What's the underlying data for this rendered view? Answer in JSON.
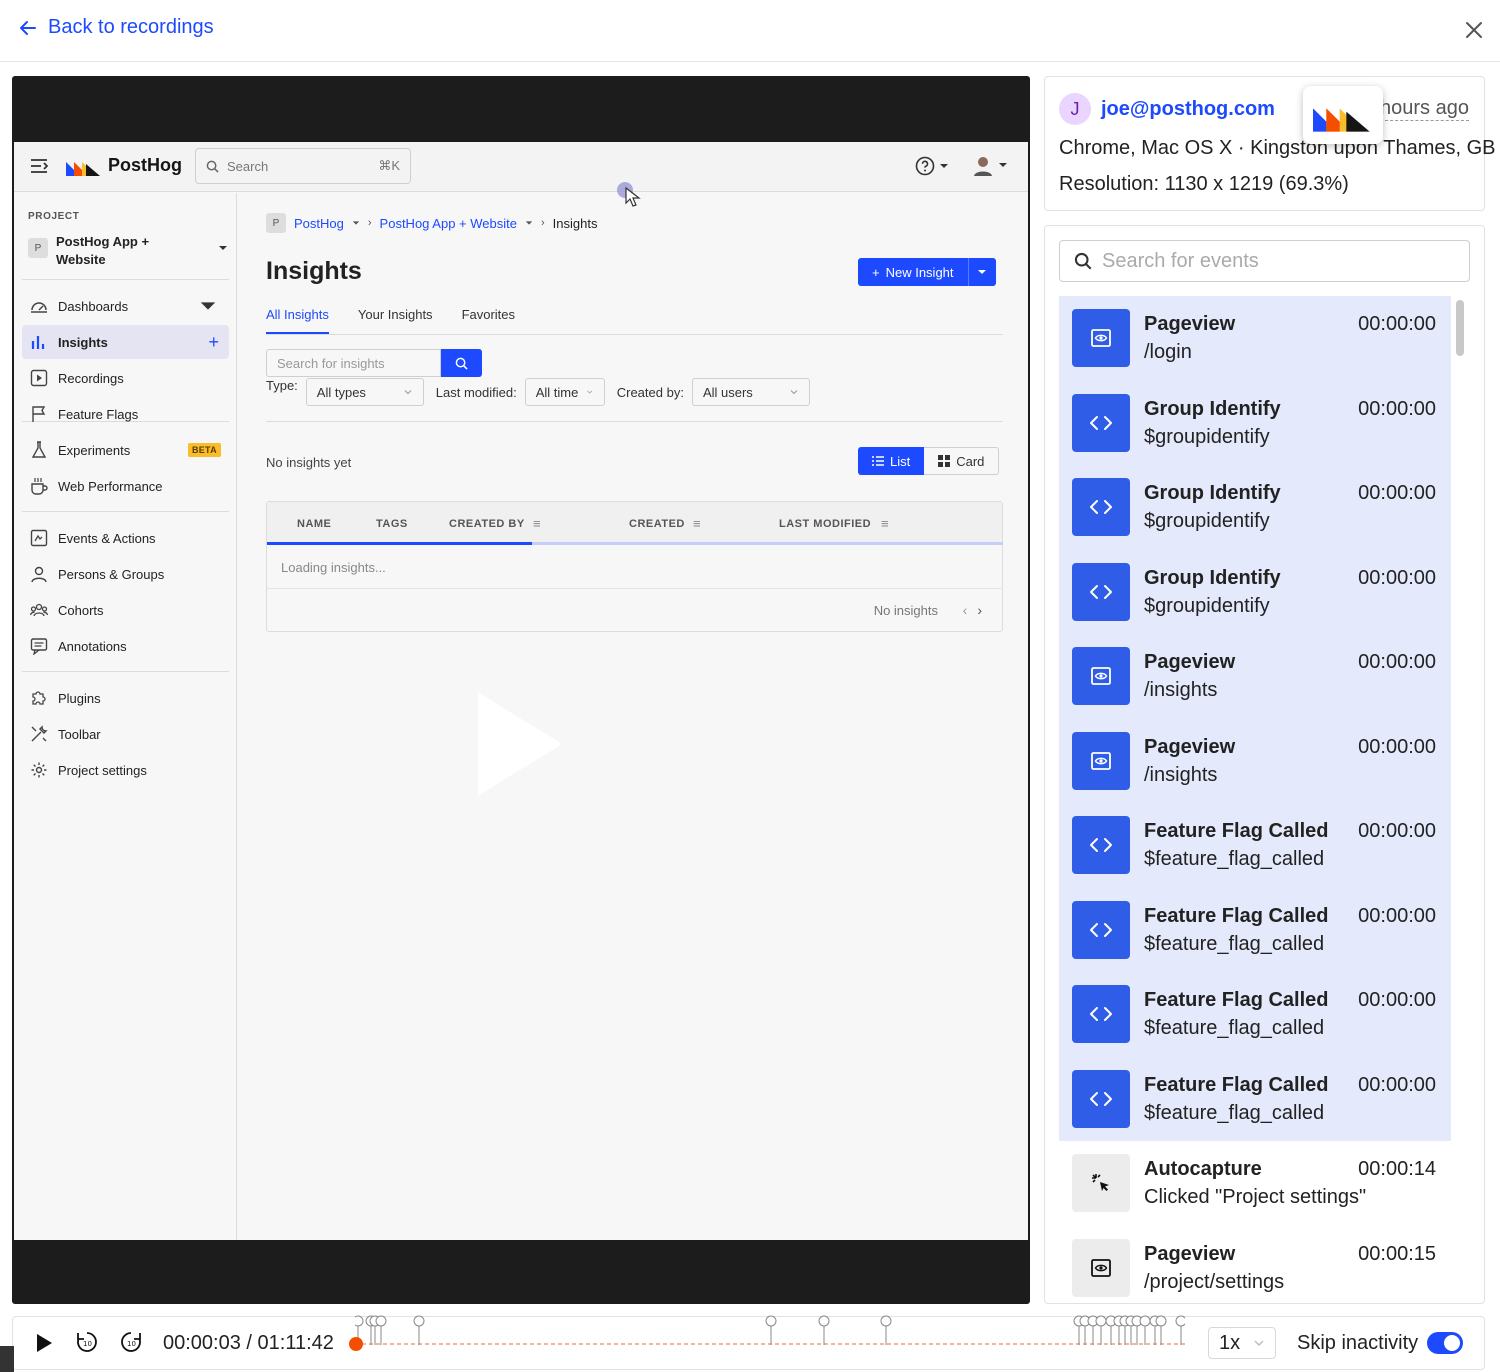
{
  "topbar": {
    "back_label": "Back to recordings"
  },
  "inner_app": {
    "logo_name": "PostHog",
    "search_placeholder": "Search",
    "search_shortcut": "⌘K",
    "project_label": "PROJECT",
    "project_badge": "P",
    "project_name": "PostHog App + Website",
    "nav": [
      {
        "label": "Dashboards",
        "icon": "dashboard-icon"
      },
      {
        "label": "Insights",
        "icon": "bar-chart-icon",
        "active": true
      },
      {
        "label": "Recordings",
        "icon": "play-square-icon"
      },
      {
        "label": "Feature Flags",
        "icon": "flag-icon"
      },
      {
        "label": "Experiments",
        "icon": "flask-icon",
        "badge": "BETA"
      },
      {
        "label": "Web Performance",
        "icon": "coffee-icon"
      },
      {
        "label": "Events & Actions",
        "icon": "events-icon"
      },
      {
        "label": "Persons & Groups",
        "icon": "person-icon"
      },
      {
        "label": "Cohorts",
        "icon": "cohort-icon"
      },
      {
        "label": "Annotations",
        "icon": "annotation-icon"
      },
      {
        "label": "Plugins",
        "icon": "puzzle-icon"
      },
      {
        "label": "Toolbar",
        "icon": "tools-icon"
      },
      {
        "label": "Project settings",
        "icon": "gear-icon"
      }
    ],
    "breadcrumb": {
      "badge": "P",
      "org": "PostHog",
      "project": "PostHog App + Website",
      "current": "Insights"
    },
    "page_title": "Insights",
    "new_insight_label": "New Insight",
    "tabs": [
      "All Insights",
      "Your Insights",
      "Favorites"
    ],
    "search_insights_placeholder": "Search for insights",
    "filters": {
      "type_label": "Type:",
      "type_value": "All types",
      "modified_label": "Last modified:",
      "modified_value": "All time",
      "created_label": "Created by:",
      "created_value": "All users"
    },
    "no_insights_yet": "No insights yet",
    "view_list": "List",
    "view_card": "Card",
    "columns": [
      "NAME",
      "TAGS",
      "CREATED BY",
      "CREATED",
      "LAST MODIFIED"
    ],
    "loading_text": "Loading insights...",
    "loading_progress": 0.36,
    "no_insights": "No insights"
  },
  "meta": {
    "avatar_letter": "J",
    "email": "joe@posthog.com",
    "ago": "hours ago",
    "device": "Chrome, Mac OS X · Kingston upon Thames, GB",
    "resolution": "Resolution: 1130 x 1219 (69.3%)"
  },
  "events": {
    "search_placeholder": "Search for events",
    "items": [
      {
        "title": "Pageview",
        "sub": "/login",
        "time": "00:00:00",
        "icon": "pageview-icon",
        "highlight": true
      },
      {
        "title": "Group Identify",
        "sub": "$groupidentify",
        "time": "00:00:00",
        "icon": "code-icon",
        "highlight": true
      },
      {
        "title": "Group Identify",
        "sub": "$groupidentify",
        "time": "00:00:00",
        "icon": "code-icon",
        "highlight": true
      },
      {
        "title": "Group Identify",
        "sub": "$groupidentify",
        "time": "00:00:00",
        "icon": "code-icon",
        "highlight": true
      },
      {
        "title": "Pageview",
        "sub": "/insights",
        "time": "00:00:00",
        "icon": "pageview-icon",
        "highlight": true
      },
      {
        "title": "Pageview",
        "sub": "/insights",
        "time": "00:00:00",
        "icon": "pageview-icon",
        "highlight": true
      },
      {
        "title": "Feature Flag Called",
        "sub": "$feature_flag_called",
        "time": "00:00:00",
        "icon": "code-icon",
        "highlight": true
      },
      {
        "title": "Feature Flag Called",
        "sub": "$feature_flag_called",
        "time": "00:00:00",
        "icon": "code-icon",
        "highlight": true
      },
      {
        "title": "Feature Flag Called",
        "sub": "$feature_flag_called",
        "time": "00:00:00",
        "icon": "code-icon",
        "highlight": true
      },
      {
        "title": "Feature Flag Called",
        "sub": "$feature_flag_called",
        "time": "00:00:00",
        "icon": "code-icon",
        "highlight": true
      },
      {
        "title": "Autocapture",
        "sub": "Clicked \"Project settings\"",
        "time": "00:00:14",
        "icon": "autocapture-icon",
        "highlight": false
      },
      {
        "title": "Pageview",
        "sub": "/project/settings",
        "time": "00:00:15",
        "icon": "pageview-icon",
        "highlight": false
      }
    ]
  },
  "controls": {
    "time": "00:00:03 / 01:11:42",
    "speed": "1x",
    "skip_label": "Skip inactivity",
    "skip_enabled": true,
    "progress": 0.0004
  },
  "colors": {
    "accent": "#1d4aff",
    "event_icon": "#2f5de8",
    "highlight_row": "#e4eafb",
    "playhead": "#f54e00"
  }
}
